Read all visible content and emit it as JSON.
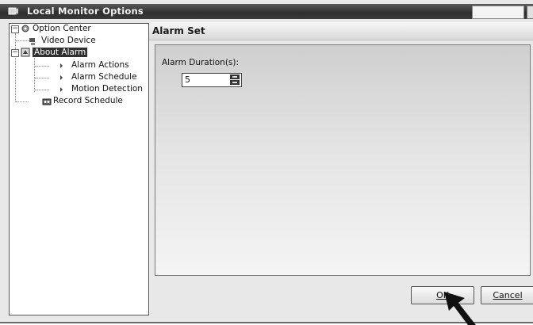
{
  "window": {
    "title": "Local Monitor Options"
  },
  "tree": {
    "items": [
      {
        "label": "Option Center",
        "icon": "gear-icon",
        "expander": "−"
      },
      {
        "label": "Video Device",
        "icon": "camera-icon"
      },
      {
        "label": "About Alarm",
        "icon": "alarm-icon",
        "expander": "−",
        "selected": true
      },
      {
        "label": "Alarm Actions",
        "icon": "bullet-icon"
      },
      {
        "label": "Alarm Schedule",
        "icon": "bullet-icon"
      },
      {
        "label": "Motion Detection",
        "icon": "bullet-icon"
      },
      {
        "label": "Record Schedule",
        "icon": "record-icon"
      }
    ]
  },
  "panel": {
    "title": "Alarm Set",
    "duration_label": "Alarm Duration(s):",
    "duration_value": "5"
  },
  "buttons": {
    "ok_label": "OK",
    "cancel_label": "Cancel"
  }
}
